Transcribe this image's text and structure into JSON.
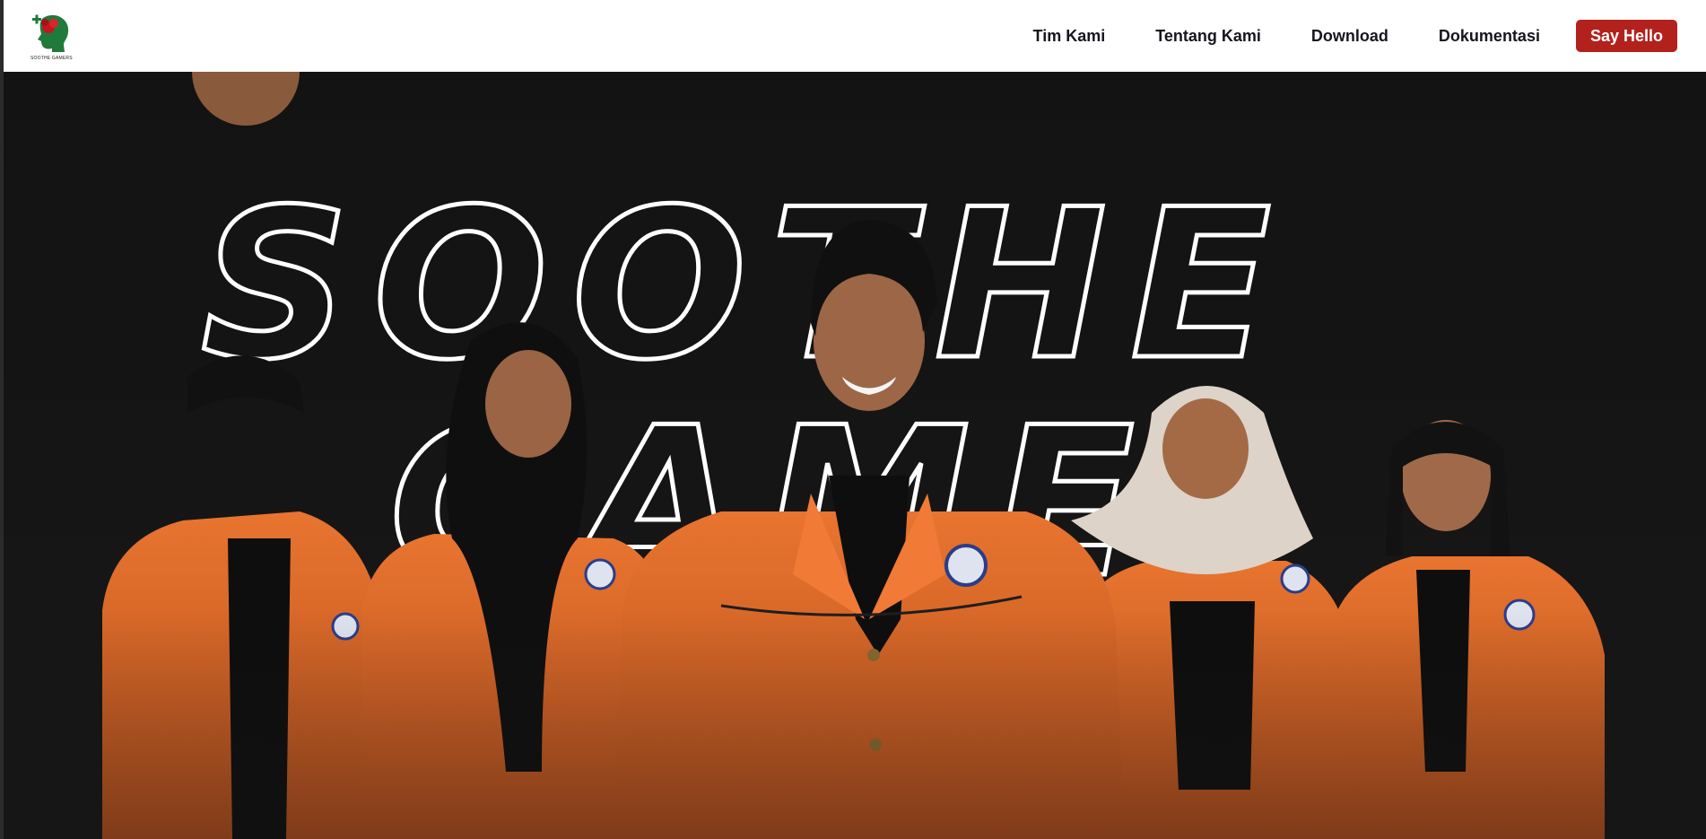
{
  "header": {
    "logo_text": "SOOTHE GAMERS",
    "logo_icon": "brain-rose-icon",
    "nav": [
      {
        "label": "Tim Kami"
      },
      {
        "label": "Tentang Kami"
      },
      {
        "label": "Download"
      },
      {
        "label": "Dokumentasi"
      }
    ],
    "cta_label": "Say Hello"
  },
  "hero": {
    "title_line1": "SOOTHE",
    "title_line2": "GAME",
    "photo_description": "five team members in orange jackets",
    "colors": {
      "background": "#151515",
      "jacket": "#e06a2c",
      "accent": "#b3211d"
    }
  }
}
